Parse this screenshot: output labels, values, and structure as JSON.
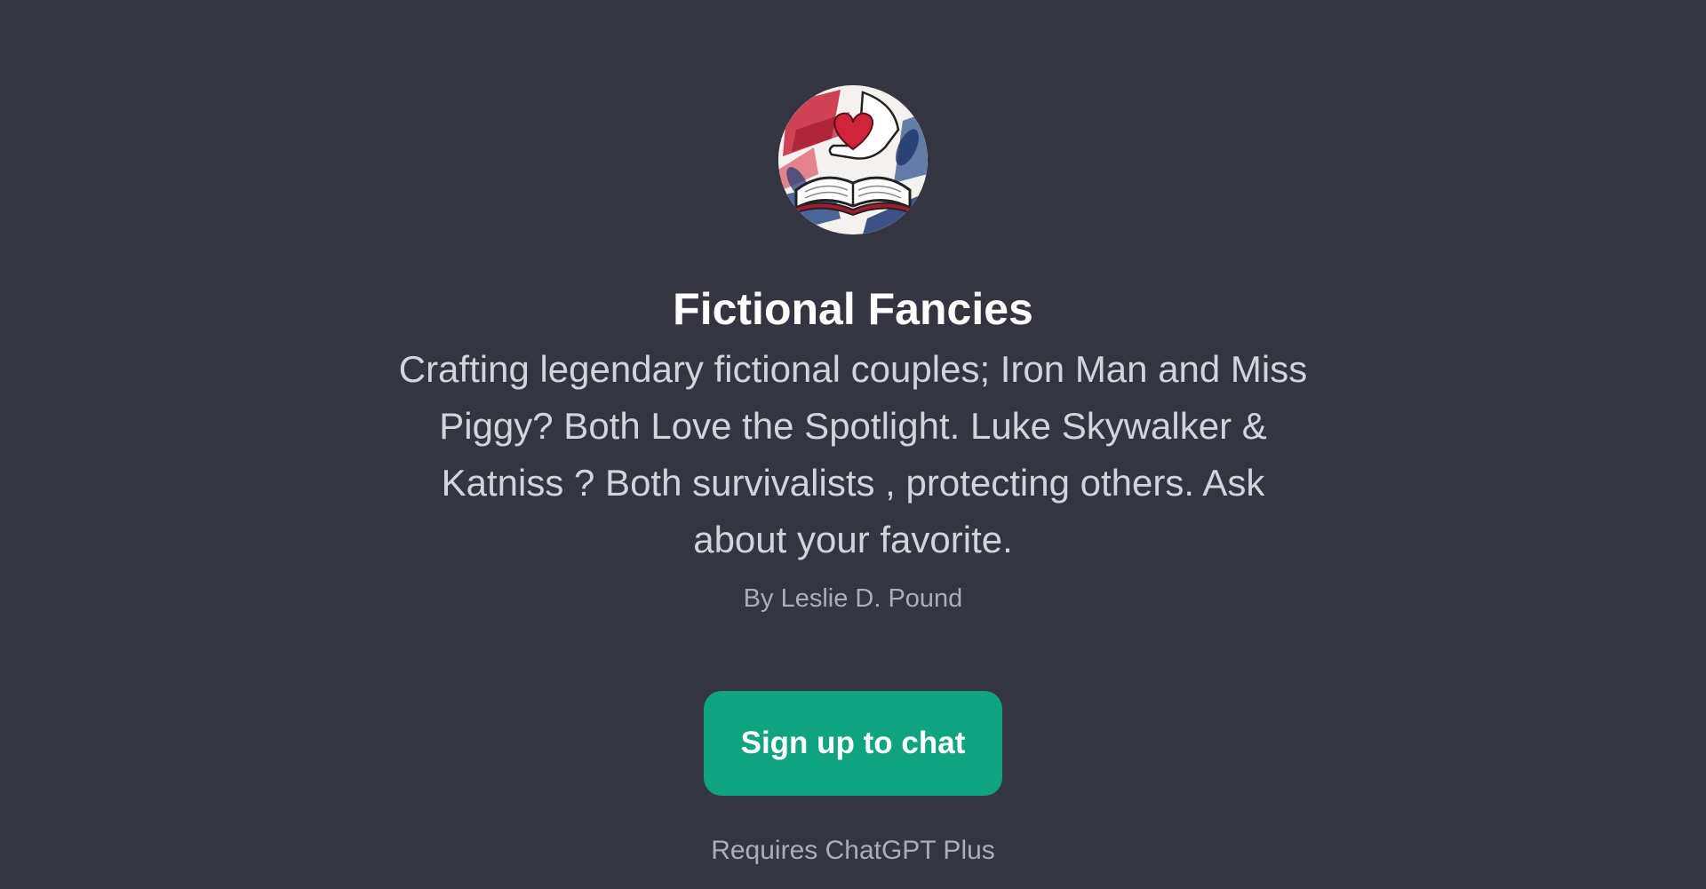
{
  "gpt": {
    "avatar_icon": "heart-book-icon",
    "title": "Fictional Fancies",
    "description": "Crafting legendary fictional couples; Iron Man and Miss Piggy? Both Love the Spotlight. Luke Skywalker & Katniss ? Both survivalists , protecting others. Ask about your favorite.",
    "author": "By Leslie D. Pound"
  },
  "cta": {
    "signup_label": "Sign up to chat",
    "requirement": "Requires ChatGPT Plus"
  },
  "colors": {
    "background": "#343541",
    "accent": "#10a37f",
    "title": "#ffffff",
    "text": "#d3d3dc",
    "muted": "#acacbe"
  }
}
